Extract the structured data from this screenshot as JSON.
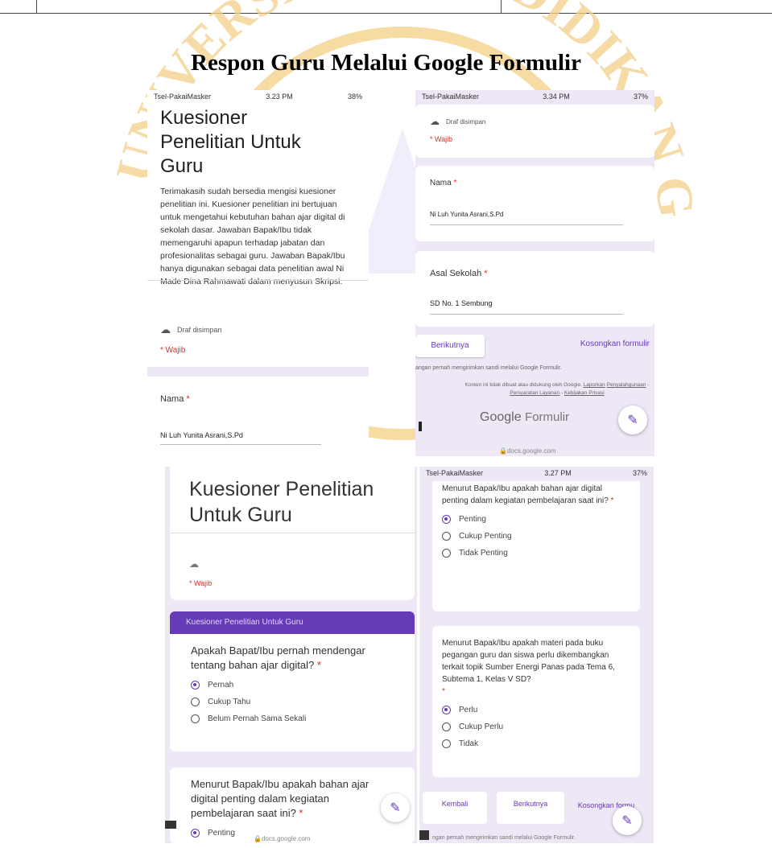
{
  "figure_title": "Respon Guru Melalui Google Formulir",
  "watermark_text": "UNIVERSITAS PENDIDIKAN GANESHA",
  "colors": {
    "accent": "#673ab7",
    "required": "#d93025",
    "watermark": "#f3d08a",
    "page_bg": "#ede7f6"
  },
  "shot1": {
    "status_left": "Tsel-PakaiMasker",
    "status_time": "3.23 PM",
    "status_right": "38%",
    "title": "Kuesioner Penelitian Untuk Guru",
    "description": "Terimakasih sudah bersedia mengisi kuesioner penelitian ini. Kuesioner penelitian ini bertujuan untuk mengetahui kebutuhan bahan ajar digital di sekolah dasar. Jawaban Bapak/Ibu tidak memengaruhi apapun terhadap jabatan dan profesionalitas sebagai guru. Jawaban Bapak/Ibu hanya digunakan sebagai data penelitian awal Ni Made Dina Rahmawati dalam menyusun Skripsi.",
    "draft": "Draf disimpan",
    "required": "* Wajib",
    "name_label": "Nama",
    "name_value": "Ni Luh Yunita Asrani,S.Pd"
  },
  "shot2": {
    "status_left": "Tsel-PakaiMasker",
    "status_time": "3.34 PM",
    "status_right": "37%",
    "draft": "Draf disimpan",
    "required": "* Wajib",
    "name_label": "Nama",
    "name_value": "Ni Luh Yunita Asrani,S.Pd",
    "school_label": "Asal Sekolah",
    "school_value": "SD No. 1 Sembung",
    "next_button": "Berikutnya",
    "clear_button": "Kosongkan formulir",
    "never_submit": "angan pernah mengirimkan sandi melalui Google Formulir.",
    "disclaimer_1": "Konten ini tidak dibuat atau didukung oleh Google.",
    "disclaimer_links": [
      "Laporkan",
      "Penyalahgunaan",
      "Persyaratan Layanan",
      "Kebijakan Privasi"
    ],
    "logo_google": "Google",
    "logo_formulir": "Formulir",
    "url": "docs.google.com"
  },
  "shot3": {
    "title": "Kuesioner Penelitian Untuk Guru",
    "required": "* Wajib",
    "section_header": "Kuesioner Penelitian Untuk Guru",
    "q1": "Apakah Bapat/Ibu pernah mendengar tentang bahan ajar digital?",
    "q1_options": [
      "Pernah",
      "Cukup Tahu",
      "Belum Pernah Sama Sekali"
    ],
    "q2": "Menurut Bapak/Ibu apakah bahan ajar digital penting dalam kegiatan pembelajaran saat ini?",
    "q2_option_first": "Penting",
    "url": "docs.google.com"
  },
  "shot4": {
    "status_left": "Tsel-PakaiMasker",
    "status_time": "3.27 PM",
    "status_right": "37%",
    "q1": "Menurut Bapak/Ibu apakah bahan ajar digital penting dalam kegiatan pembelajaran saat ini?",
    "q1_options": [
      "Penting",
      "Cukup Penting",
      "Tidak Penting"
    ],
    "q2": "Menurut Bapak/Ibu apakah materi pada buku pegangan guru dan siswa perlu dikembangkan terkait topik Sumber Energi Panas pada Tema 6, Subtema 1, Kelas V SD?",
    "q2_options": [
      "Perlu",
      "Cukup Perlu",
      "Tidak"
    ],
    "back_button": "Kembali",
    "next_button": "Berikutnya",
    "clear_button": "Kosongkan formu",
    "footer": "ngan pernah mengirimkan sandi melalui Google Formulir."
  }
}
